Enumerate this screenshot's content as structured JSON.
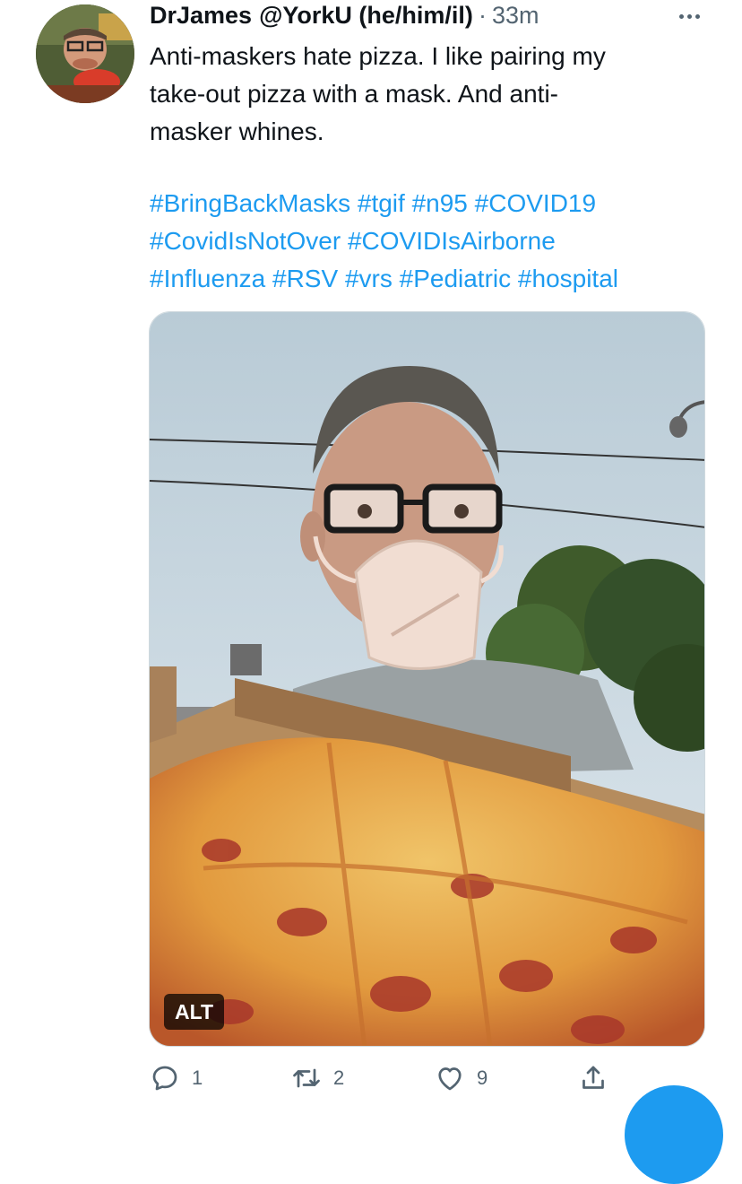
{
  "tweet": {
    "author_name": "DrJames",
    "author_handle": "@YorkU (he/him/il)",
    "separator": "·",
    "timestamp": "33m",
    "text": "Anti-maskers hate pizza.  I like pairing my\ntake-out pizza with a mask. And anti-\nmasker whines.",
    "hashtag_lines": [
      [
        "#BringBackMasks",
        "#tgif",
        "#n95",
        "#COVID19"
      ],
      [
        "#CovidIsNotOver",
        "#COVIDIsAirborne"
      ],
      [
        "#Influenza",
        "#RSV",
        "#vrs",
        "#Pediatric",
        "#hospital"
      ]
    ],
    "media": {
      "alt_label": "ALT"
    },
    "actions": {
      "replies": "1",
      "retweets": "2",
      "likes": "9"
    }
  },
  "colors": {
    "accent": "#1d9bf0",
    "secondary_text": "#536471",
    "primary_text": "#0f1419"
  },
  "icons": [
    "more-icon",
    "reply-icon",
    "retweet-icon",
    "like-icon",
    "share-icon"
  ]
}
